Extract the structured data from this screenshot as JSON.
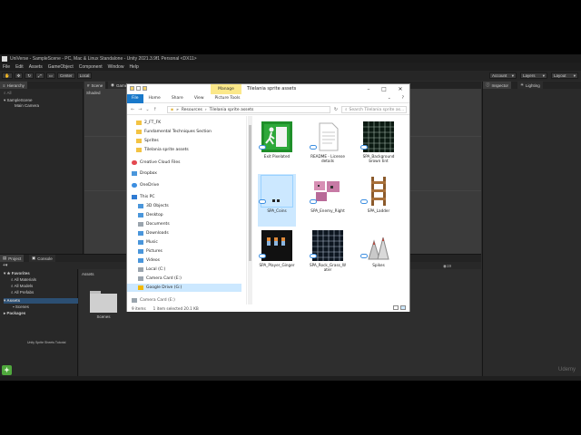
{
  "unity": {
    "title": "UniVerse - SampleScene - PC, Mac & Linux Standalone - Unity 2021.3.9f1 Personal <DX11>",
    "menu": [
      "File",
      "Edit",
      "Assets",
      "GameObject",
      "Component",
      "Window",
      "Help"
    ],
    "toolbar": {
      "center_label": "Center",
      "local_label": "Local",
      "account_label": "Account",
      "layers_label": "Layers",
      "layout_label": "Layout"
    },
    "hierarchy": {
      "tab": "Hierarchy",
      "search_placeholder": "All",
      "scene_name": "SampleScene",
      "items": [
        "Main Camera"
      ]
    },
    "scene": {
      "tabs": [
        "Scene",
        "Game"
      ],
      "shading_mode": "Shaded"
    },
    "inspector": {
      "tabs": [
        "Inspector",
        "Lighting"
      ]
    },
    "project": {
      "tabs": [
        "Project",
        "Console"
      ],
      "add_label": "+",
      "favorites_label": "Favorites",
      "favorites": [
        "All Materials",
        "All Models",
        "All Prefabs"
      ],
      "assets_label": "Assets",
      "asset_children": [
        "Scenes"
      ],
      "packages_label": "Packages",
      "breadcrumb": "Assets",
      "folders": [
        "Scenes"
      ],
      "count_badge": "19"
    },
    "bottom_caption": "Unity Sprite Sheets Tutorial",
    "watermark": "Udemy"
  },
  "explorer": {
    "title": "Tilelania sprite assets",
    "manage_label": "Manage",
    "picture_tools_label": "Picture Tools",
    "ribbon_tabs": [
      "File",
      "Home",
      "Share",
      "View"
    ],
    "address": [
      "Resources",
      "Tilelania sprite assets"
    ],
    "search_placeholder": "Search Tilelania sprite as...",
    "nav_items": [
      {
        "label": "2_FT_FK",
        "icon": "folder-icon"
      },
      {
        "label": "Fundamental Techniques Section",
        "icon": "folder-icon"
      },
      {
        "label": "Sprites",
        "icon": "folder-icon"
      },
      {
        "label": "Tilelania sprite assets",
        "icon": "folder-icon"
      },
      {
        "label": "Creative Cloud Files",
        "icon": "cloud-icon"
      },
      {
        "label": "Dropbox",
        "icon": "dropbox-icon"
      },
      {
        "label": "OneDrive",
        "icon": "cloud-icon"
      },
      {
        "label": "This PC",
        "icon": "pc-icon"
      },
      {
        "label": "3D Objects",
        "icon": "cube-icon"
      },
      {
        "label": "Desktop",
        "icon": "desktop-icon"
      },
      {
        "label": "Documents",
        "icon": "documents-icon"
      },
      {
        "label": "Downloads",
        "icon": "download-icon"
      },
      {
        "label": "Music",
        "icon": "music-icon"
      },
      {
        "label": "Pictures",
        "icon": "pictures-icon"
      },
      {
        "label": "Videos",
        "icon": "videos-icon"
      },
      {
        "label": "Local (C:)",
        "icon": "drive-icon"
      },
      {
        "label": "Camera Card (E:)",
        "icon": "drive-icon"
      },
      {
        "label": "Google Drive (G:)",
        "icon": "google-drive-icon"
      },
      {
        "label": "Camera Card (E:)",
        "icon": "drive-icon"
      }
    ],
    "files": [
      {
        "name": "Exit Pixelated",
        "kind": "exit"
      },
      {
        "name": "README - License details",
        "kind": "doc"
      },
      {
        "name": "SPA_Background brown tint",
        "kind": "grid-dark"
      },
      {
        "name": "SPA_Coins",
        "kind": "coins"
      },
      {
        "name": "SPA_Enemy_Right",
        "kind": "enemy"
      },
      {
        "name": "SPA_Ladder",
        "kind": "ladder"
      },
      {
        "name": "SPA_Player_Ginger",
        "kind": "player"
      },
      {
        "name": "SPA_Rock_Grass_Water",
        "kind": "grid-rock"
      },
      {
        "name": "Spikes",
        "kind": "spikes"
      }
    ],
    "status": {
      "items": "9 items",
      "selected": "1 item selected  20.1 KB"
    },
    "colors": {
      "accent": "#1979ca",
      "manage": "#fbe88a",
      "selected": "#cce8ff"
    }
  }
}
